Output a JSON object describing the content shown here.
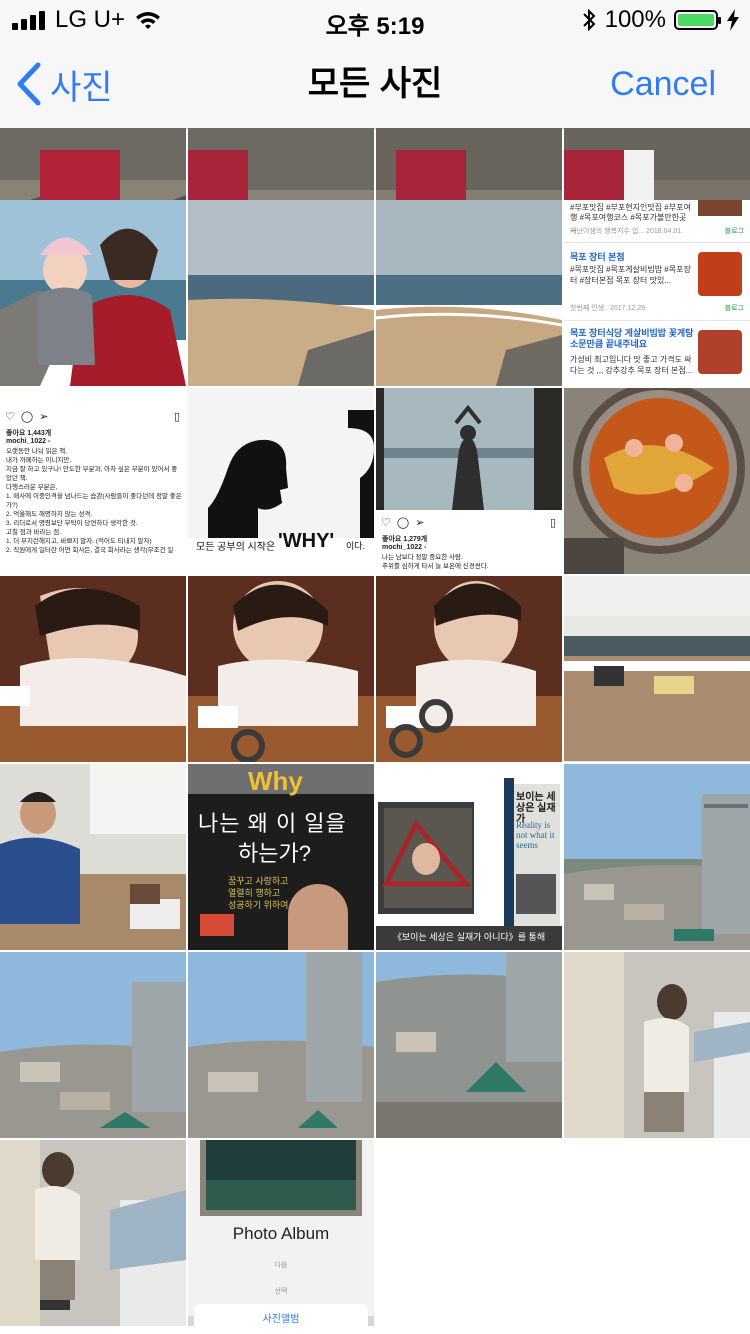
{
  "status_bar": {
    "carrier": "LG U+",
    "time": "오후 5:19",
    "battery_percent": "100%"
  },
  "nav": {
    "back_label": "사진",
    "title": "모든 사진",
    "cancel_label": "Cancel"
  },
  "photos": {
    "blog_1_tags": "#부포맛집 #부포현지인맛집 #부포여",
    "blog_1_sub": "행 #목포여행코스 #목포가볼만한곳 ...",
    "blog_1_meta": "재닌이샘의 행복지수 업...   2018.04.01.",
    "blog_1_badge": "블로그",
    "blog_2_title": "목포 장터 본점",
    "blog_2_text": "#목포맛집 #목포게살비빔밥 #목포장터 #장터본점 목포 장터 맛있...",
    "blog_2_meta": "찻번째 인생..   2017.12.29.",
    "blog_2_badge": "블로그",
    "blog_3_title": "목포 장터식당 게살비빔밥 꽃게탕 소문만큼 끝내주네요",
    "blog_3_text": "가성비 최고입니다 맛 좋고 가격도 싸다는 것 ,,, 강추강추 목포 장터 본점...",
    "insta_1_likes": "좋아요 1,443개",
    "insta_1_user": "mochi_1022 -",
    "insta_1_lines": [
      "오랫동안 나눠 읽은 책.",
      "내가 까페하는 이니지만,",
      "지금 잘 하고 있구나! 안도한 부분과, 아차 싶은 부분이 있어서 좋았던 책.",
      "다행스러운 부분은,",
      "1. 매사에 이중인격을 넘나드는 습관(사람들이 좋다던데 정말 좋은가?)",
      "2. 억울해도 해명하지 않는 성격.",
      "3. 리더로서 명령보단 부탁이 당연하다 생각한 것.",
      "고칠 점과 바라는 점.",
      "1. 더 부지런해지고, 바쁘지 말자. (적어도 티내지 말자)",
      "2. 직원에게 일터란 어떤 회사든, 결국 회사라는 생각(무조건 일"
    ],
    "why_caption": "모든 공부의 시작은",
    "why_word": "'WHY'",
    "why_suffix": "이다.",
    "insta_2_likes": "좋아요 1,279개",
    "insta_2_user": "mochi_1022 -",
    "insta_2_lines": [
      "나는 남보다 정말 중요한 사람.",
      "추위를 심하게 타서 늘 보온에 신경썬다."
    ],
    "book_why": "Why",
    "book_title_1": "나는 왜 이 일을",
    "book_title_2": "하는가?",
    "book_sub_1": "꿈꾸고 사랑하고",
    "book_sub_2": "열렬히 행하고",
    "book_sub_3": "성공하기 위하여",
    "book2_title": "보이는 세상은 실재가",
    "book2_en": "Reality is not what it seems",
    "book2_caption": "《보이는 세상은 실재가 아니다》를 통해",
    "album_title": "Photo Album",
    "album_opt_1": "다음",
    "album_opt_2": "선택",
    "album_button": "사진앨범"
  },
  "icons": {
    "back": "chevron-left-icon",
    "heart": "heart-icon",
    "comment": "comment-icon",
    "share": "share-icon",
    "bookmark": "bookmark-icon"
  },
  "colors": {
    "accent": "#2f7cf6",
    "battery": "#4cd964"
  }
}
